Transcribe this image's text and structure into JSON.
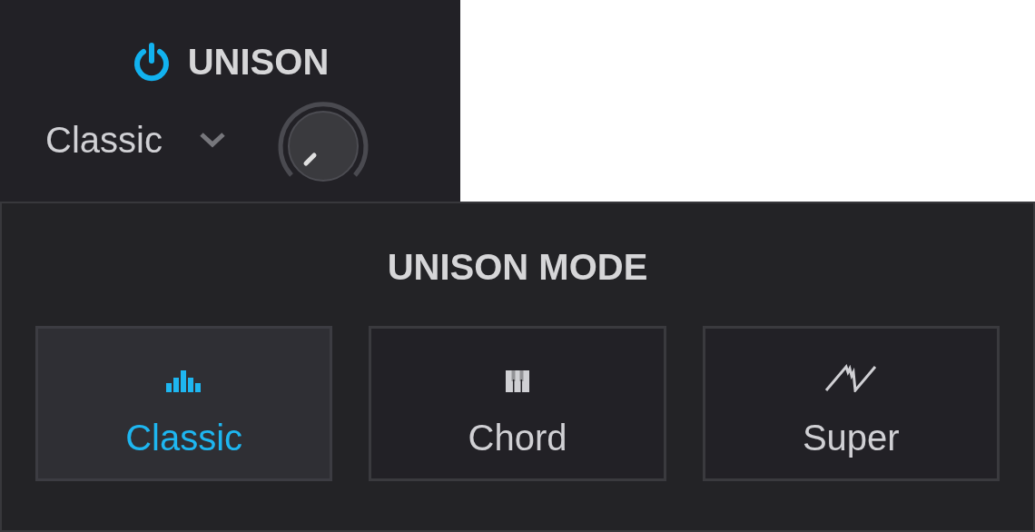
{
  "unison": {
    "title": "UNISON",
    "power_on": true,
    "mode_value": "Classic"
  },
  "mode_panel": {
    "title": "UNISON MODE",
    "options": [
      {
        "label": "Classic",
        "kind": "bars",
        "selected": true
      },
      {
        "label": "Chord",
        "kind": "keys",
        "selected": false
      },
      {
        "label": "Super",
        "kind": "saw",
        "selected": false
      }
    ]
  }
}
